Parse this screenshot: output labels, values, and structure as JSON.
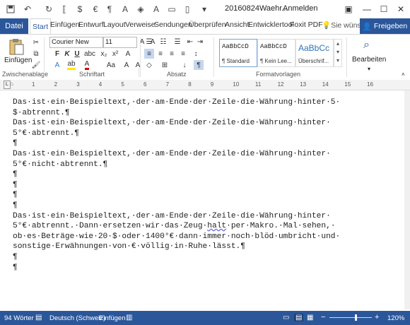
{
  "titlebar": {
    "title": "20160824Waehr...",
    "signin": "Anmelden",
    "qat": [
      "save-icon",
      "undo-icon",
      "redo-icon",
      "icon-a",
      "icon-b",
      "icon-c",
      "icon-d",
      "icon-e",
      "icon-f",
      "icon-g",
      "icon-h"
    ]
  },
  "tabs": {
    "datei": "Datei",
    "start": "Start",
    "items": [
      "Einfügen",
      "Entwurf",
      "Layout",
      "Verweise",
      "Sendungen",
      "Überprüfen",
      "Ansicht",
      "Entwicklertool",
      "Foxit PDF"
    ],
    "tell_me": "Sie wüns",
    "share": "Freigeben"
  },
  "ribbon": {
    "paste": "Einfügen",
    "font_name": "Courier New",
    "font_size": "11",
    "bold": "F",
    "italic": "K",
    "underline": "U",
    "styles": [
      {
        "sample": "AaBbCcD",
        "name": "¶ Standard"
      },
      {
        "sample": "AaBbCcD",
        "name": "¶ Kein Lee..."
      },
      {
        "sample": "AaBbCc",
        "name": "Überschrif..."
      }
    ],
    "edit": "Bearbeiten",
    "groups": {
      "clipboard": "Zwischenablage",
      "font": "Schriftart",
      "paragraph": "Absatz",
      "styles": "Formatvorlagen"
    }
  },
  "ruler": {
    "numbers": [
      "1",
      "2",
      "3",
      "4",
      "5",
      "6",
      "7",
      "8",
      "9",
      "10",
      "11",
      "12",
      "13",
      "14",
      "15",
      "16"
    ]
  },
  "document": {
    "p1": "Das·ist·ein·Beispieltext,·der·am·Ende·der·Zeile·die·Währung·hinter·5·\n$·abtrennt.¶",
    "p2": "Das·ist·ein·Beispieltext,·der·am·Ende·der·Zeile·die·Währung·hinter·\n5°€·abtrennt.¶",
    "p3": "¶",
    "p4": "Das·ist·ein·Beispieltext,·der·am·Ende·der·Zeile·die·Währung·hinter·\n5°€·nicht·abtrennt.¶",
    "p5": "¶",
    "p6": "¶",
    "p7": "¶",
    "p8": "¶",
    "p9a": "Das·ist·ein·Beispieltext,·der·am·Ende·der·Zeile·die·Währung·hinter·\n5°€·abtrennt.·Dann·ersetzen·wir·das·Zeug·",
    "p9b": "halt",
    "p9c": "·per·Makro.·Mal·sehen,·\nob·es·Beträge·wie·20·$·oder·1400°€·dann·immer·noch·blöd·umbricht·und·\nsonstige·Erwähnungen·von·€·völlig·in·Ruhe·lässt.¶",
    "p10": "¶",
    "p11": "¶"
  },
  "status": {
    "words": "94 Wörter",
    "language": "Deutsch (Schweiz)",
    "mode": "Einfügen",
    "zoom": "120%"
  }
}
